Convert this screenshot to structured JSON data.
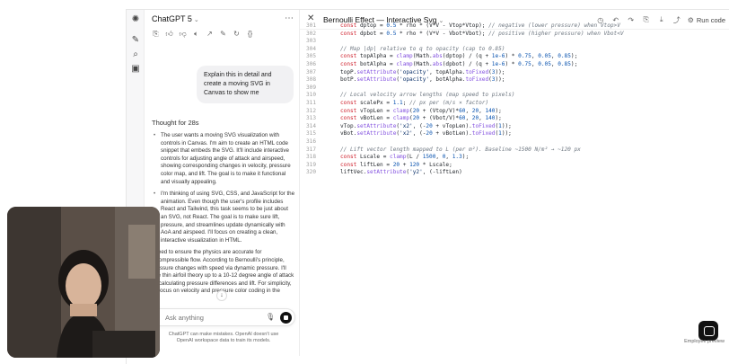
{
  "rail": {
    "icons": [
      "chatgpt-logo-icon",
      "edit-icon",
      "search-icon",
      "library-icon"
    ]
  },
  "chat": {
    "model_name": "ChatGPT 5",
    "actions": [
      "copy-icon",
      "thumbs-up-icon",
      "thumbs-down-icon",
      "speaker-icon",
      "share-icon",
      "edit-icon",
      "regenerate-icon",
      "code-icon"
    ],
    "user_message": "Explain this in detail and create a moving SVG in Canvas to show me",
    "thought_label": "Thought for 28s",
    "bullets": [
      "The user wants a moving SVG visualization with controls in Canvas. I'm aim to create an HTML code snippet that embeds the SVG. It'll include interactive controls for adjusting angle of attack and airspeed, showing corresponding changes in velocity, pressure color map, and lift. The goal is to make it functional and visually appealing.",
      "I'm thinking of using SVG, CSS, and JavaScript for the animation. Even though the user's profile includes React and Tailwind, this task seems to be just about an SVG, not React. The goal is to make sure lift, pressure, and streamlines update dynamically with AoA and airspeed. I'll focus on creating a clean, interactive visualization in HTML."
    ],
    "paragraph": "I need to ensure the physics are accurate for incompressible flow. According to Bernoulli's principle, pressure changes with speed via dynamic pressure. I'll use thin airfoil theory up to a 10-12 degree angle of attack — calculating pressure differences and lift. For simplicity, I'll focus on velocity and pressure color coding in the",
    "input_placeholder": "Ask anything",
    "disclaimer": "ChatGPT can make mistakes. OpenAI doesn't use OpenAI workspace data to train its models."
  },
  "canvas": {
    "title": "Bernoulli Effect — Interactive Svg",
    "run_label": "Run code",
    "preview_label": "Employee preview",
    "code_lines": [
      {
        "n": "301",
        "t": "const dptop = 0.5 * rho * (V*V - Vtop*Vtop); // negative (lower pressure) when Vtop>V"
      },
      {
        "n": "302",
        "t": "const dpbot = 0.5 * rho * (V*V - Vbot*Vbot); // positive (higher pressure) when Vbot<V"
      },
      {
        "n": "303",
        "t": ""
      },
      {
        "n": "304",
        "t": "// Map |dp| relative to q to opacity (cap to 0.85)"
      },
      {
        "n": "305",
        "t": "const topAlpha = clamp(Math.abs(dptop) / (q + 1e-6) * 0.75, 0.05, 0.85);"
      },
      {
        "n": "306",
        "t": "const botAlpha = clamp(Math.abs(dpbot) / (q + 1e-6) * 0.75, 0.05, 0.85);"
      },
      {
        "n": "307",
        "t": "topP.setAttribute('opacity', topAlpha.toFixed(3));"
      },
      {
        "n": "308",
        "t": "botP.setAttribute('opacity', botAlpha.toFixed(3));"
      },
      {
        "n": "309",
        "t": ""
      },
      {
        "n": "310",
        "t": "// Local velocity arrow lengths (map speed to pixels)"
      },
      {
        "n": "311",
        "t": "const scalePx = 1.1; // px per (m/s × factor)"
      },
      {
        "n": "312",
        "t": "const vTopLen = clamp(20 + (Vtop/V)*60, 20, 140);"
      },
      {
        "n": "313",
        "t": "const vBotLen = clamp(20 + (Vbot/V)*60, 20, 140);"
      },
      {
        "n": "314",
        "t": "vTop.setAttribute('x2', (-20 + vTopLen).toFixed(1));"
      },
      {
        "n": "315",
        "t": "vBot.setAttribute('x2', (-20 + vBotLen).toFixed(1));"
      },
      {
        "n": "316",
        "t": ""
      },
      {
        "n": "317",
        "t": "// Lift vector length mapped to L (per m²). Baseline ~1500 N/m² → ~120 px"
      },
      {
        "n": "318",
        "t": "const Lscale = clamp(L / 1500, 0, 1.3);"
      },
      {
        "n": "319",
        "t": "const liftLen = 20 + 120 * Lscale;"
      },
      {
        "n": "320",
        "t": "liftVec.setAttribute('y2', (-liftLen)"
      }
    ]
  },
  "webcam": {
    "description_icon": "webcam-person-icon"
  }
}
